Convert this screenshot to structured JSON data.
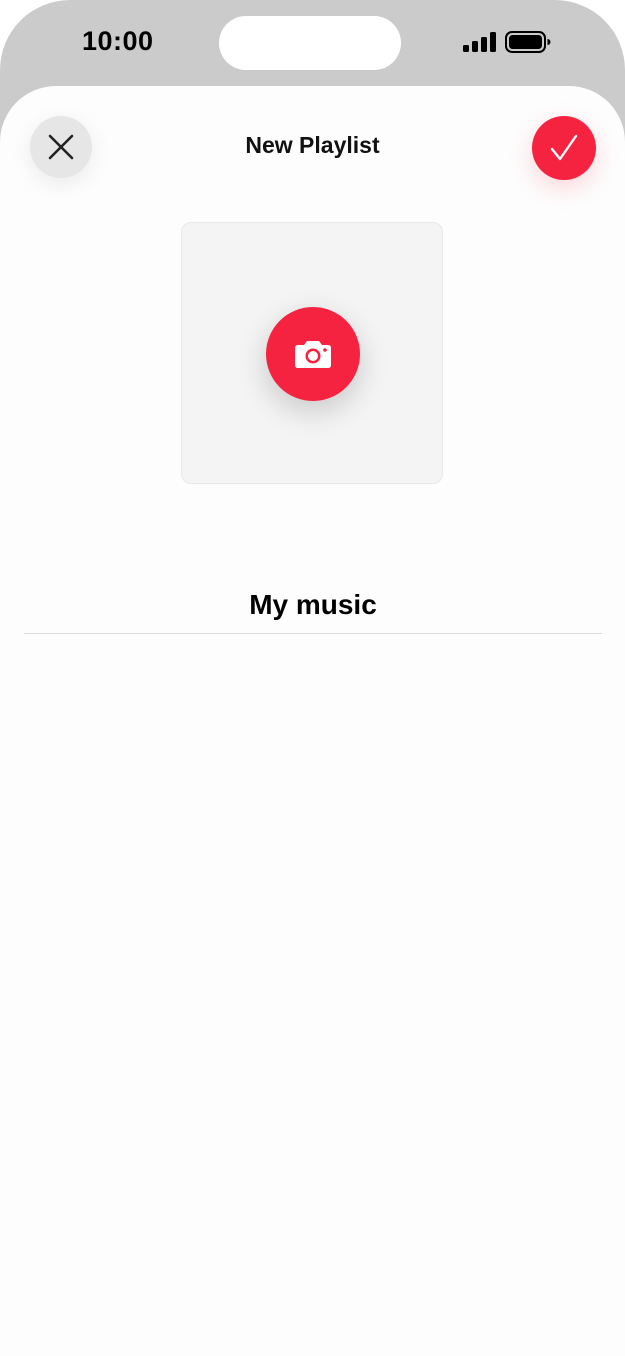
{
  "status_bar": {
    "time": "10:00",
    "signal_icon": "cellular-signal-icon",
    "battery_icon": "battery-icon"
  },
  "header": {
    "title": "New Playlist",
    "close_icon": "close-icon",
    "done_icon": "checkmark-icon"
  },
  "artwork": {
    "camera_icon": "camera-icon"
  },
  "playlist_name": {
    "value": "My music"
  },
  "colors": {
    "accent": "#f5233f",
    "frame": "#cbcbcb",
    "sheet_background": "#fdfdfd",
    "close_button_background": "#e6e6e6",
    "artwork_background": "#f4f4f4"
  }
}
